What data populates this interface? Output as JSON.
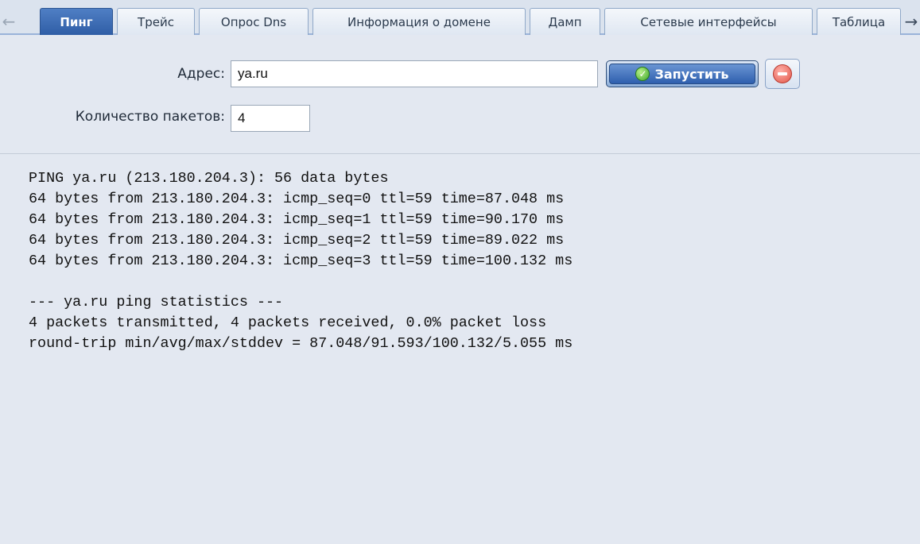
{
  "tabs": [
    {
      "label": "Пинг",
      "active": true
    },
    {
      "label": "Трейс",
      "active": false
    },
    {
      "label": "Опрос Dns",
      "active": false
    },
    {
      "label": "Информация о домене",
      "active": false
    },
    {
      "label": "Дамп",
      "active": false
    },
    {
      "label": "Сетевые интерфейсы",
      "active": false
    },
    {
      "label": "Таблица",
      "active": false
    }
  ],
  "icons": {
    "scroll_left": "arrow-left-icon",
    "scroll_right": "arrow-right-icon",
    "run": "check-circle-icon",
    "stop": "minus-circle-icon"
  },
  "form": {
    "address_label": "Адрес:",
    "address_value": "ya.ru",
    "packets_label": "Количество пакетов:",
    "packets_value": "4",
    "run_label": "Запустить"
  },
  "output": {
    "lines": [
      "PING ya.ru (213.180.204.3): 56 data bytes",
      "64 bytes from 213.180.204.3: icmp_seq=0 ttl=59 time=87.048 ms",
      "64 bytes from 213.180.204.3: icmp_seq=1 ttl=59 time=90.170 ms",
      "64 bytes from 213.180.204.3: icmp_seq=2 ttl=59 time=89.022 ms",
      "64 bytes from 213.180.204.3: icmp_seq=3 ttl=59 time=100.132 ms",
      "",
      "--- ya.ru ping statistics ---",
      "4 packets transmitted, 4 packets received, 0.0% packet loss",
      "round-trip min/avg/max/stddev = 87.048/91.593/100.132/5.055 ms"
    ]
  },
  "colors": {
    "background": "#e3e8f1",
    "active_tab": "#3a6bb5",
    "run_button": "#2e5fae"
  }
}
